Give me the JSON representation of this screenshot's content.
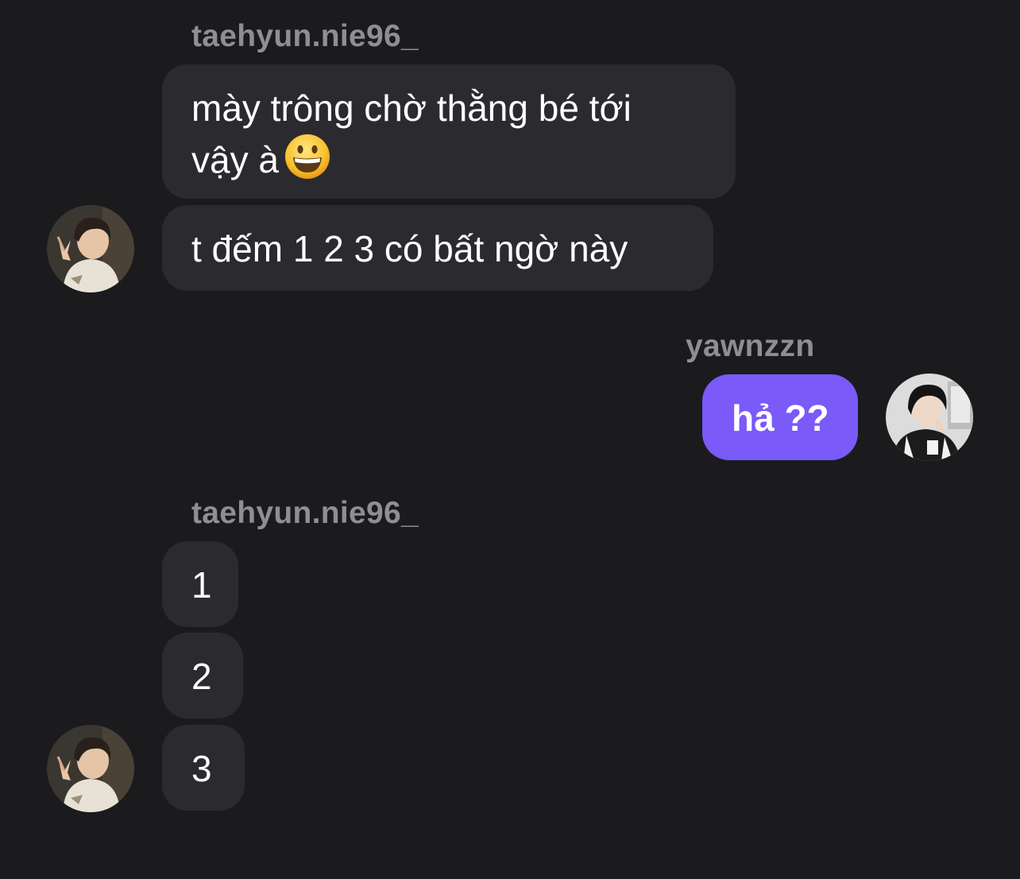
{
  "group1": {
    "sender": "taehyun.nie96_",
    "messages": [
      {
        "line1": "mày trông chờ thằng bé tới",
        "line2": "vậy à",
        "emoji": "grinning-face-emoji"
      },
      {
        "text": "t đếm 1 2 3 có bất ngờ này"
      }
    ]
  },
  "group2": {
    "sender": "yawnzzn",
    "messages": [
      {
        "text": "hả ??"
      }
    ]
  },
  "group3": {
    "sender": "taehyun.nie96_",
    "messages": [
      {
        "text": "1"
      },
      {
        "text": "2"
      },
      {
        "text": "3"
      }
    ]
  },
  "colors": {
    "background": "#1b1b1e",
    "incoming_bubble": "#2b2b2f",
    "outgoing_bubble": "#7a5af8",
    "sender_name": "#8e8e93"
  }
}
